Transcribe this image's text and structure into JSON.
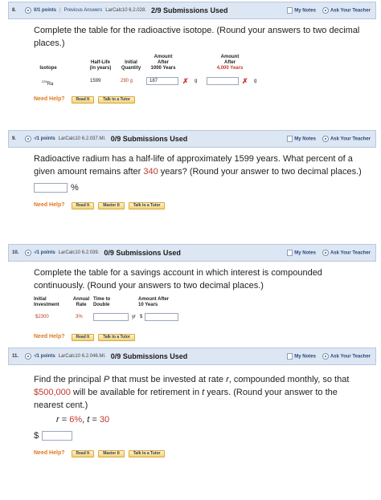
{
  "q8": {
    "num": "8.",
    "points": "0/1 points",
    "sep": "|",
    "prev": "Previous Answers",
    "code": "LarCalc10 6.2.028.",
    "subs": "2/9 Submissions Used",
    "my_notes": "My Notes",
    "ask": "Ask Your Teacher",
    "prompt": "Complete the table for the radioactive isotope. (Round your answers to two decimal places.)",
    "table": {
      "h_isotope": "Isotope",
      "h_halflife_1": "Half-Life",
      "h_halflife_2": "(in years)",
      "h_initial_1": "Initial",
      "h_initial_2": "Quantity",
      "h_after1000_1": "Amount",
      "h_after1000_2": "After",
      "h_after1000_3": "1000 Years",
      "h_after4000_1": "Amount",
      "h_after4000_2": "After",
      "h_after4000_3": "4,000 Years",
      "isotope_sup": "226",
      "isotope": "Ra",
      "halflife": "1599",
      "initial": "290 g",
      "answer_1000": "187",
      "unit": "g"
    },
    "need_help": "Need Help?",
    "btn_read": "Read It",
    "btn_talk": "Talk to a Tutor"
  },
  "q9": {
    "num": "9.",
    "points": "-/1 points",
    "code": "LarCalc10 6.2.037.MI.",
    "subs": "0/9 Submissions Used",
    "my_notes": "My Notes",
    "ask": "Ask Your Teacher",
    "prompt_a": "Radioactive radium has a half-life of approximately 1599 years. What percent of a given amount remains after ",
    "prompt_red": "340",
    "prompt_b": " years? (Round your answer to two decimal places.)",
    "unit": "%",
    "need_help": "Need Help?",
    "btn_read": "Read It",
    "btn_master": "Master It",
    "btn_talk": "Talk to a Tutor"
  },
  "q10": {
    "num": "10.",
    "points": "-/1 points",
    "code": "LarCalc10 6.2.039.",
    "subs": "0/9 Submissions Used",
    "my_notes": "My Notes",
    "ask": "Ask Your Teacher",
    "prompt": "Complete the table for a savings account in which interest is compounded continuously. (Round your answers to two decimal places.)",
    "table": {
      "h_initial_1": "Initial",
      "h_initial_2": "Investment",
      "h_rate_1": "Annual",
      "h_rate_2": "Rate",
      "h_double_1": "Time to",
      "h_double_2": "Double",
      "h_amount_1": "Amount After",
      "h_amount_2": "10 Years",
      "initial": "$2300",
      "rate": "3%",
      "unit_yr": "yr",
      "dollar": "$"
    },
    "need_help": "Need Help?",
    "btn_read": "Read It",
    "btn_talk": "Talk to a Tutor"
  },
  "q11": {
    "num": "11.",
    "points": "-/1 points",
    "code": "LarCalc10 6.2.046.MI.",
    "subs": "0/9 Submissions Used",
    "my_notes": "My Notes",
    "ask": "Ask Your Teacher",
    "prompt_a": "Find the principal ",
    "prompt_P": "P",
    "prompt_b": " that must be invested at rate ",
    "prompt_r": "r",
    "prompt_c": ", compounded monthly, so that ",
    "prompt_red": "$500,000",
    "prompt_d": " will be available for retirement in ",
    "prompt_t": "t",
    "prompt_e": " years. (Round your answer to the nearest cent.)",
    "given_r": "r",
    "given_eq1": " = ",
    "given_rate": "6%",
    "given_comma": ", ",
    "given_t": "t",
    "given_eq2": " = ",
    "given_years": "30",
    "dollar": "$",
    "need_help": "Need Help?",
    "btn_read": "Read It",
    "btn_master": "Master It",
    "btn_talk": "Talk to a Tutor"
  },
  "colors": {
    "header_bg": "#dde6f3",
    "highlight_red": "#c0392b",
    "need_help_orange": "#e07820",
    "button_gold": "#f4d47a"
  }
}
